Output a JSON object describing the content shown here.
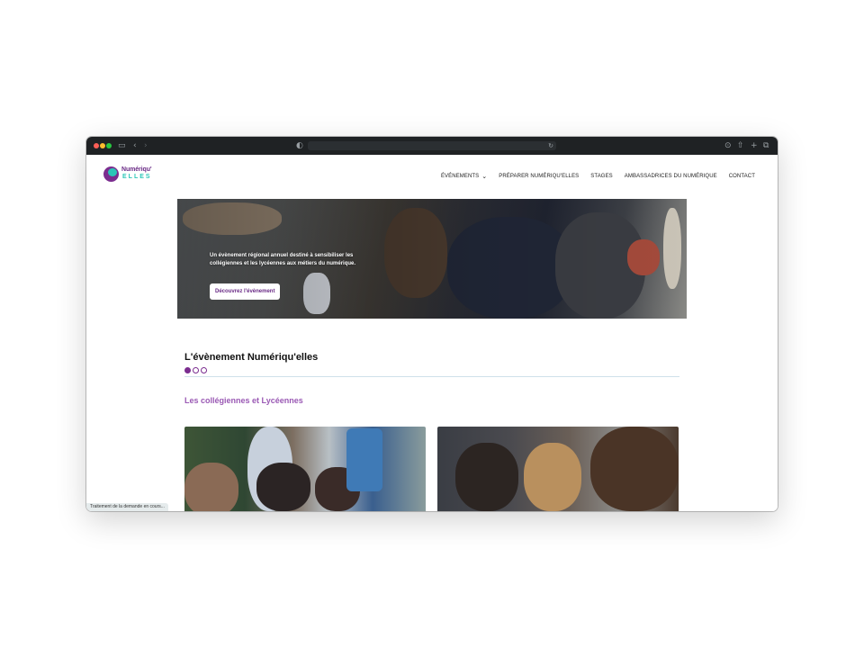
{
  "site": {
    "logo_top": "Numériqu'",
    "logo_bottom": "ELLES"
  },
  "nav": {
    "items": [
      {
        "label": "ÉVÉNEMENTS",
        "has_dropdown": true
      },
      {
        "label": "PRÉPARER NUMÉRIQU'ELLES"
      },
      {
        "label": "STAGES"
      },
      {
        "label": "AMBASSADRICES DU NUMÉRIQUE"
      },
      {
        "label": "CONTACT"
      }
    ]
  },
  "hero": {
    "text": "Un évènement régional annuel destiné à sensibiliser les collégiennes et les lycéennes aux métiers du numérique.",
    "button_label": "Découvrez l'évènement"
  },
  "section": {
    "title": "L'évènement Numériqu'elles",
    "pager_count": 3,
    "pager_active": 1,
    "subtitle": "Les collégiennes et Lycéennes"
  },
  "status_bar": "Traitement de la demande en cours...",
  "colors": {
    "brand_purple": "#7b2d8f",
    "brand_teal": "#2bc6b7",
    "subtitle_purple": "#9a59b4",
    "titlebar": "#1f2224"
  }
}
